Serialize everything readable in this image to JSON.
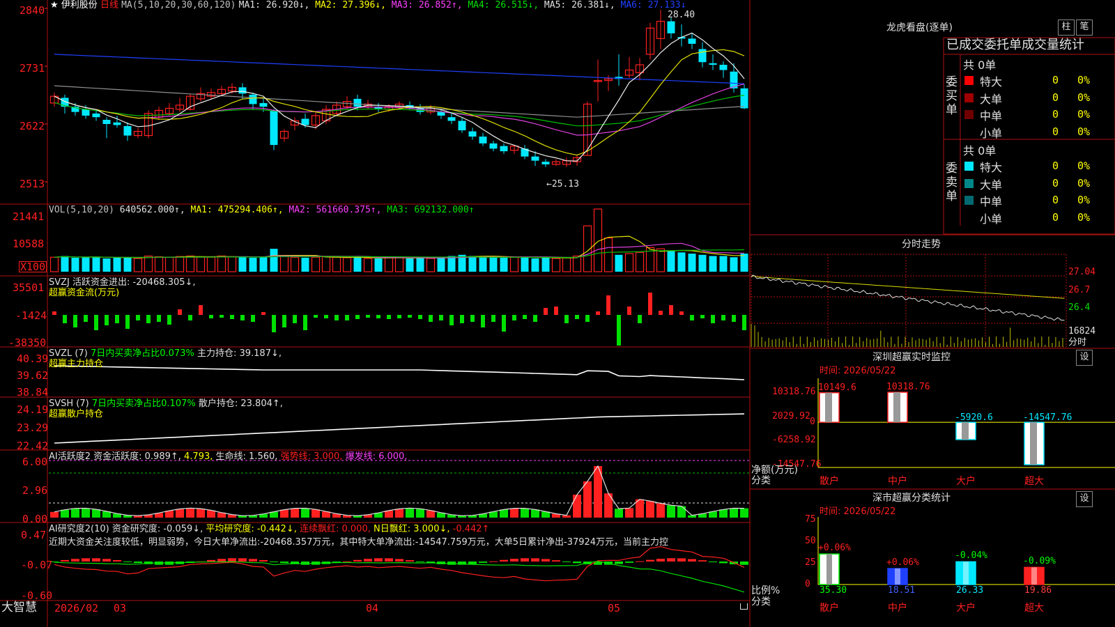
{
  "stock": {
    "name": "伊利股份",
    "period": "日线"
  },
  "main": {
    "ma_label": "MA(5,10,20,30,60,120)",
    "ma": [
      {
        "label": "MA1: 26.920↓,",
        "color": "#e0e0e0"
      },
      {
        "label": "MA2: 27.396↓,",
        "color": "#ffff00"
      },
      {
        "label": "MA3: 26.852↑,",
        "color": "#ff40ff"
      },
      {
        "label": "MA4: 26.515↓,",
        "color": "#00e000"
      },
      {
        "label": "MA5: 26.381↓,",
        "color": "#e0e0e0"
      },
      {
        "label": "MA6: 27.133↓",
        "color": "#2040ff"
      }
    ],
    "y_ticks": [
      "2840",
      "2731",
      "2622",
      "2513"
    ],
    "high_mark": "28.40",
    "low_mark": "←25.13"
  },
  "candles": [
    [
      26.62,
      26.75,
      26.82,
      26.55
    ],
    [
      26.72,
      26.55,
      26.78,
      26.42
    ],
    [
      26.55,
      26.45,
      26.62,
      26.38
    ],
    [
      26.5,
      26.38,
      26.58,
      26.32
    ],
    [
      26.42,
      26.35,
      26.5,
      26.28
    ],
    [
      26.3,
      26.22,
      26.35,
      25.95
    ],
    [
      26.25,
      26.2,
      26.38,
      26.15
    ],
    [
      26.18,
      26.0,
      26.25,
      25.9
    ],
    [
      26.0,
      26.08,
      26.15,
      25.95
    ],
    [
      26.0,
      26.42,
      26.48,
      25.95
    ],
    [
      26.35,
      26.48,
      26.55,
      26.3
    ],
    [
      26.42,
      26.52,
      26.62,
      26.38
    ],
    [
      26.5,
      26.58,
      26.72,
      26.45
    ],
    [
      26.5,
      26.75,
      26.8,
      26.48
    ],
    [
      26.7,
      26.8,
      26.92,
      26.65
    ],
    [
      26.75,
      26.82,
      26.9,
      26.7
    ],
    [
      26.8,
      26.88,
      26.95,
      26.75
    ],
    [
      26.85,
      26.92,
      27.0,
      26.8
    ],
    [
      26.92,
      26.8,
      27.0,
      26.7
    ],
    [
      26.78,
      26.6,
      26.82,
      26.5
    ],
    [
      26.62,
      26.55,
      26.7,
      26.45
    ],
    [
      26.48,
      25.82,
      26.5,
      25.72
    ],
    [
      25.95,
      26.08,
      26.12,
      25.88
    ],
    [
      26.2,
      26.28,
      26.35,
      26.1
    ],
    [
      26.32,
      26.2,
      26.42,
      26.15
    ],
    [
      26.2,
      26.38,
      26.45,
      26.12
    ],
    [
      26.28,
      26.5,
      26.58,
      26.22
    ],
    [
      26.42,
      26.58,
      26.65,
      26.38
    ],
    [
      26.55,
      26.65,
      26.75,
      26.5
    ],
    [
      26.7,
      26.55,
      26.78,
      26.48
    ],
    [
      26.55,
      26.6,
      26.68,
      26.5
    ],
    [
      26.55,
      26.5,
      26.62,
      26.45
    ],
    [
      26.5,
      26.55,
      26.6,
      26.45
    ],
    [
      26.55,
      26.6,
      26.65,
      26.5
    ],
    [
      26.58,
      26.52,
      26.65,
      26.48
    ],
    [
      26.52,
      26.45,
      26.6,
      26.4
    ],
    [
      26.45,
      26.52,
      26.58,
      26.4
    ],
    [
      26.45,
      26.38,
      26.5,
      26.32
    ],
    [
      26.35,
      26.28,
      26.42,
      26.22
    ],
    [
      26.28,
      26.1,
      26.35,
      26.05
    ],
    [
      26.08,
      25.98,
      26.15,
      25.92
    ],
    [
      25.98,
      25.85,
      26.05,
      25.8
    ],
    [
      25.85,
      25.75,
      25.9,
      25.7
    ],
    [
      25.8,
      25.7,
      25.85,
      25.65
    ],
    [
      25.72,
      25.8,
      25.82,
      25.65
    ],
    [
      25.75,
      25.6,
      25.82,
      25.55
    ],
    [
      25.6,
      25.52,
      25.7,
      25.42
    ],
    [
      25.5,
      25.45,
      25.55,
      25.4
    ],
    [
      25.45,
      25.5,
      25.55,
      25.42
    ],
    [
      25.45,
      25.52,
      25.58,
      25.4
    ],
    [
      25.5,
      25.58,
      25.62,
      25.42
    ],
    [
      25.62,
      26.6,
      26.65,
      25.62
    ],
    [
      27.05,
      27.05,
      27.45,
      26.65
    ],
    [
      27.05,
      27.08,
      27.15,
      26.85
    ],
    [
      27.12,
      27.08,
      27.55,
      26.95
    ],
    [
      27.15,
      27.25,
      27.5,
      27.1
    ],
    [
      27.2,
      27.35,
      27.48,
      27.05
    ],
    [
      27.55,
      28.05,
      28.15,
      27.45
    ],
    [
      27.85,
      28.18,
      28.4,
      27.65
    ],
    [
      28.18,
      27.95,
      28.25,
      27.85
    ],
    [
      27.88,
      27.85,
      28.12,
      27.7
    ],
    [
      27.85,
      27.75,
      27.95,
      27.65
    ],
    [
      27.65,
      27.4,
      27.78,
      27.3
    ],
    [
      27.38,
      27.35,
      27.55,
      27.25
    ],
    [
      27.35,
      27.25,
      27.42,
      27.1
    ],
    [
      27.22,
      26.9,
      27.38,
      26.82
    ],
    [
      26.9,
      26.52,
      26.98,
      26.5
    ]
  ],
  "vol": {
    "label": "VOL(5,10,20)",
    "value": "640562.000↑,",
    "ma1": "MA1: 475294.406↑,",
    "ma2": "MA2: 561660.375↑,",
    "ma3": "MA3: 692132.000↑",
    "y_ticks": [
      "21441",
      "10588"
    ],
    "unit": "X100",
    "bars": [
      6,
      6.5,
      5.8,
      6,
      6.2,
      5.5,
      5.8,
      6,
      5.5,
      6.5,
      6.2,
      6,
      6.3,
      6.5,
      6.2,
      6,
      6.5,
      6.2,
      6,
      5.8,
      6,
      9.5,
      6.5,
      6,
      5.8,
      6,
      6.2,
      6,
      5.8,
      6,
      5.5,
      5.5,
      6,
      6,
      5.5,
      5.8,
      5.5,
      5.8,
      6.5,
      7,
      6.5,
      6.2,
      6,
      5.8,
      6,
      6.2,
      5.5,
      5.8,
      5.5,
      5.8,
      6.5,
      19,
      26,
      14,
      7,
      7.5,
      8,
      10,
      9.5,
      8.5,
      8,
      7.5,
      7,
      6.5,
      6.5,
      6,
      7.5
    ]
  },
  "svzj": {
    "label": "SVZJ  活跃资金进出: -20468.305↓,",
    "sub": "超赢资金流(万元)",
    "y_ticks": [
      "35501",
      "-1424",
      "-38350"
    ],
    "bars": [
      5,
      -12,
      -18,
      -10,
      -22,
      -15,
      -12,
      -20,
      -8,
      -12,
      -10,
      -14,
      8,
      -8,
      14,
      -5,
      -4,
      -6,
      -8,
      -10,
      4,
      -25,
      -18,
      -12,
      -22,
      -4,
      -5,
      -8,
      -8,
      -6,
      -4,
      -5,
      -6,
      -5,
      -4,
      -6,
      -10,
      -8,
      -15,
      -12,
      -10,
      -18,
      -10,
      -24,
      -8,
      -6,
      -10,
      10,
      12,
      -12,
      -6,
      -10,
      5,
      28,
      -44,
      12,
      -12,
      32,
      6,
      14,
      5,
      -8,
      -5,
      -12,
      -8,
      -10,
      -22
    ]
  },
  "svzl": {
    "prefix": "SVZL (7)",
    "label": "7日内买卖净占比0.073%",
    "hold": "主力持仓: 39.187↓,",
    "sub": "超赢主力持仓",
    "y_ticks": [
      "40.39",
      "39.62",
      "38.84"
    ]
  },
  "svsh": {
    "prefix": "SVSH (7)",
    "label": "7日内买卖净占比0.107%",
    "hold": "散户持仓: 23.804↑,",
    "sub": "超赢散户持仓",
    "y_ticks": [
      "24.19",
      "23.29",
      "22.42"
    ]
  },
  "ai1": {
    "label": "AI活跃度2 资金活跃度: 0.989↑,",
    "v2": "4.793,",
    "life": "生命线: 1.560,",
    "strong": "强势线: 3.000,",
    "burst": "爆发线: 6.000,",
    "y_ticks": [
      "6.00",
      "2.96",
      "0.00"
    ]
  },
  "ai2": {
    "label": "AI研究度2(10) 资金研究度: -0.059↓,",
    "avg": "平均研究度: -0.442↓,",
    "red": "连续飘红: 0.000,",
    "nred": "N日飘红: 3.000↓,",
    "tail": "-0.442↑",
    "note": "近期大资金关注度较低，明显弱势，今日大单净流出:-20468.357万元，其中特大单净流出:-14547.759万元，大单5日累计净出-37924万元，当前主力控",
    "y_ticks": [
      "0.47",
      "-0.07",
      "-0.60"
    ]
  },
  "axis": {
    "logo": "大智慧",
    "labels": [
      "2026/02",
      "03",
      "04",
      "05"
    ]
  },
  "dragon": {
    "title": "龙虎看盘(逐单)",
    "btn1": "柱",
    "btn2": "笔",
    "header": "已成交委托单成交量统计",
    "buy_label": "委买单",
    "sell_label": "委卖单",
    "buy_total": "共 0单",
    "sell_total": "共 0单",
    "buy_rows": [
      {
        "name": "特大",
        "val": "0",
        "pct": "0%",
        "color": "#ff0000"
      },
      {
        "name": "大单",
        "val": "0",
        "pct": "0%",
        "color": "#a00000"
      },
      {
        "name": "中单",
        "val": "0",
        "pct": "0%",
        "color": "#700000"
      },
      {
        "name": "小单",
        "val": "0",
        "pct": "0%",
        "color": ""
      }
    ],
    "sell_rows": [
      {
        "name": "特大",
        "val": "0",
        "pct": "0%",
        "color": "#00e8ff"
      },
      {
        "name": "大单",
        "val": "0",
        "pct": "0%",
        "color": "#008888"
      },
      {
        "name": "中单",
        "val": "0",
        "pct": "0%",
        "color": "#006a70"
      },
      {
        "name": "小单",
        "val": "0",
        "pct": "0%",
        "color": ""
      }
    ]
  },
  "intraday": {
    "title": "分时走势",
    "ticks": [
      "27.04",
      "26.7",
      "26.4"
    ],
    "vol_tick": "16824",
    "unit": "分时"
  },
  "sz_monitor": {
    "title": "深圳超赢实时监控",
    "btn": "设",
    "time": "时间: 2026/05/22",
    "y_ticks": [
      "10318.76",
      "2029.92",
      "0",
      "-6258.92",
      "-14547.76"
    ],
    "y_label_1": "净额(万元)",
    "y_label_2": "分类",
    "bars": [
      {
        "cat": "散户",
        "value": 10149.6,
        "label": "10149.6",
        "color": "#ff2020"
      },
      {
        "cat": "中户",
        "value": 10318.76,
        "label": "10318.76",
        "color": "#ff2020"
      },
      {
        "cat": "大户",
        "value": -5920.6,
        "label": "-5920.6",
        "color": "#00e8ff"
      },
      {
        "cat": "超大",
        "value": -14547.76,
        "label": "-14547.76",
        "color": "#00e8ff"
      }
    ]
  },
  "sz_stats": {
    "title": "深市超赢分类统计",
    "btn": "设",
    "time": "时间: 2026/05/22",
    "y_ticks": [
      "75",
      "50",
      "25",
      "0"
    ],
    "y_label_1": "比例%",
    "y_label_2": "分类",
    "bars": [
      {
        "cat": "散户",
        "value": 35.3,
        "label": "35.30",
        "delta": "+0.06%",
        "fill": "#ffffff",
        "accent": "#00ff00",
        "catColor": "#ff2020",
        "valColor": "#00ff00",
        "deltaColor": "#ff2020"
      },
      {
        "cat": "中户",
        "value": 18.51,
        "label": "18.51",
        "delta": "+0.06%",
        "fill": "#2040ff",
        "accent": "#2040ff",
        "catColor": "#ff2020",
        "valColor": "#4060ff",
        "deltaColor": "#ff2020"
      },
      {
        "cat": "大户",
        "value": 26.33,
        "label": "26.33",
        "delta": "-0.04%",
        "fill": "#00e8ff",
        "accent": "#00e8ff",
        "catColor": "#ff2020",
        "valColor": "#00e8ff",
        "deltaColor": "#00ff00"
      },
      {
        "cat": "超大",
        "value": 19.86,
        "label": "19.86",
        "delta": "-0.09%",
        "fill": "#ff2020",
        "accent": "#ff2020",
        "catColor": "#ff2020",
        "valColor": "#ff4040",
        "deltaColor": "#00ff00"
      }
    ]
  }
}
